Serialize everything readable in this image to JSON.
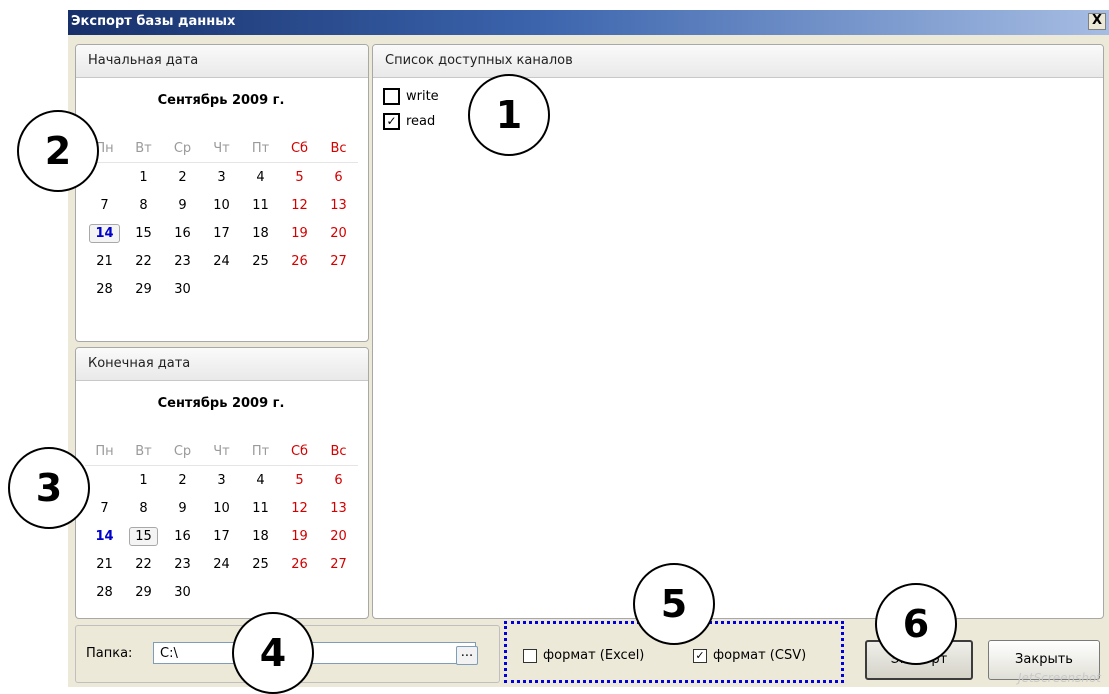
{
  "window": {
    "title": "Экспорт базы данных",
    "close_label": "X"
  },
  "start_calendar": {
    "header": "Начальная дата",
    "month_label": "Сентябрь  2009 г.",
    "weekdays": [
      "Пн",
      "Вт",
      "Ср",
      "Чт",
      "Пт",
      "Сб",
      "Вс"
    ],
    "weeks": [
      [
        "",
        "1",
        "2",
        "3",
        "4",
        "5",
        "6"
      ],
      [
        "7",
        "8",
        "9",
        "10",
        "11",
        "12",
        "13"
      ],
      [
        "14",
        "15",
        "16",
        "17",
        "18",
        "19",
        "20"
      ],
      [
        "21",
        "22",
        "23",
        "24",
        "25",
        "26",
        "27"
      ],
      [
        "28",
        "29",
        "30",
        "",
        "",
        "",
        ""
      ]
    ],
    "selected_day": "14",
    "today_day": "14"
  },
  "end_calendar": {
    "header": "Конечная дата",
    "month_label": "Сентябрь  2009 г.",
    "weekdays": [
      "Пн",
      "Вт",
      "Ср",
      "Чт",
      "Пт",
      "Сб",
      "Вс"
    ],
    "weeks": [
      [
        "",
        "1",
        "2",
        "3",
        "4",
        "5",
        "6"
      ],
      [
        "7",
        "8",
        "9",
        "10",
        "11",
        "12",
        "13"
      ],
      [
        "14",
        "15",
        "16",
        "17",
        "18",
        "19",
        "20"
      ],
      [
        "21",
        "22",
        "23",
        "24",
        "25",
        "26",
        "27"
      ],
      [
        "28",
        "29",
        "30",
        "",
        "",
        "",
        ""
      ]
    ],
    "selected_day": "15",
    "today_day": "14"
  },
  "channels": {
    "header": "Список доступных каналов",
    "items": [
      {
        "label": "write",
        "checked": false
      },
      {
        "label": "read",
        "checked": true
      }
    ]
  },
  "folder": {
    "label": "Папка:",
    "value": "C:\\",
    "browse_label": "..."
  },
  "formats": {
    "excel": {
      "label": "формат (Excel)",
      "checked": false
    },
    "csv": {
      "label": "формат (CSV)",
      "checked": true
    }
  },
  "buttons": {
    "export_label": "Экспорт",
    "close_label": "Закрыть"
  },
  "callouts": [
    "1",
    "2",
    "3",
    "4",
    "5",
    "6"
  ],
  "watermark": "JetScreenshot",
  "colors": {
    "weekend": "#d40000",
    "today": "#0000cc",
    "title_bar": "#17306a",
    "highlight_border": "#0000dd"
  }
}
